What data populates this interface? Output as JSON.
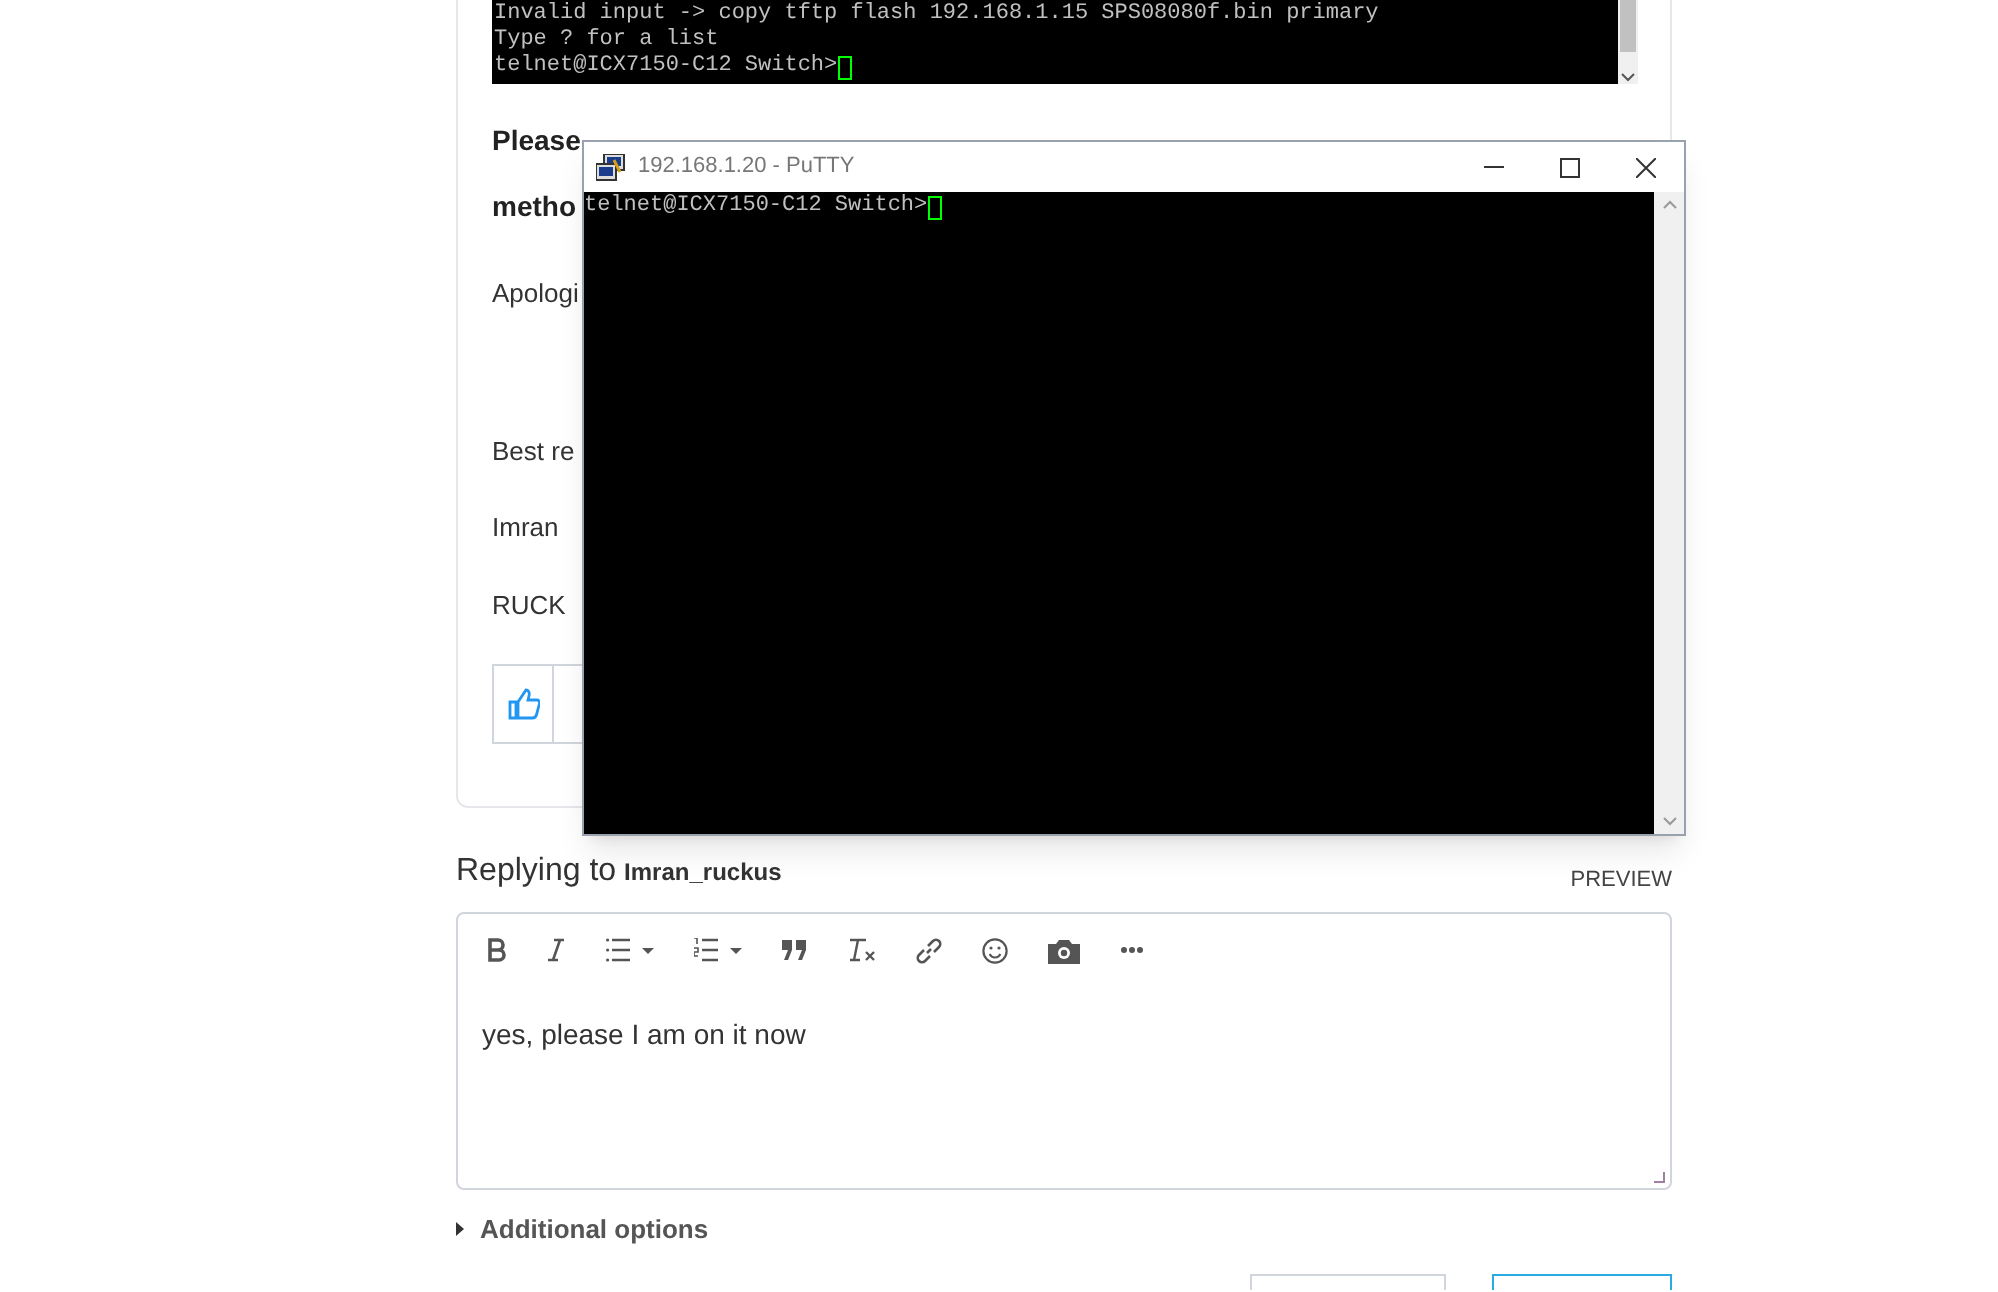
{
  "terminal_image": {
    "lines": [
      "Invalid input -> copy tftp flash 192.168.1.15 SPS08080f.bin primary",
      "Type ? for a list"
    ],
    "prompt": "telnet@ICX7150-C12 Switch>"
  },
  "post": {
    "paragraphs": [
      {
        "lines": [
          "Please",
          "metho"
        ],
        "bold": true
      },
      {
        "lines": [
          "Apologi"
        ],
        "bold": false
      },
      {
        "lines": [
          "Best re"
        ],
        "bold": false
      },
      {
        "lines": [
          "Imran"
        ],
        "bold": false
      },
      {
        "lines": [
          "RUCK"
        ],
        "bold": false
      }
    ]
  },
  "putty": {
    "title": "192.168.1.20 - PuTTY",
    "prompt": "telnet@ICX7150-C12 Switch>"
  },
  "reply": {
    "label": "Replying to",
    "user": "Imran_ruckus",
    "preview": "PREVIEW",
    "value": "yes, please I am on it now",
    "additional_options": "Additional options"
  }
}
